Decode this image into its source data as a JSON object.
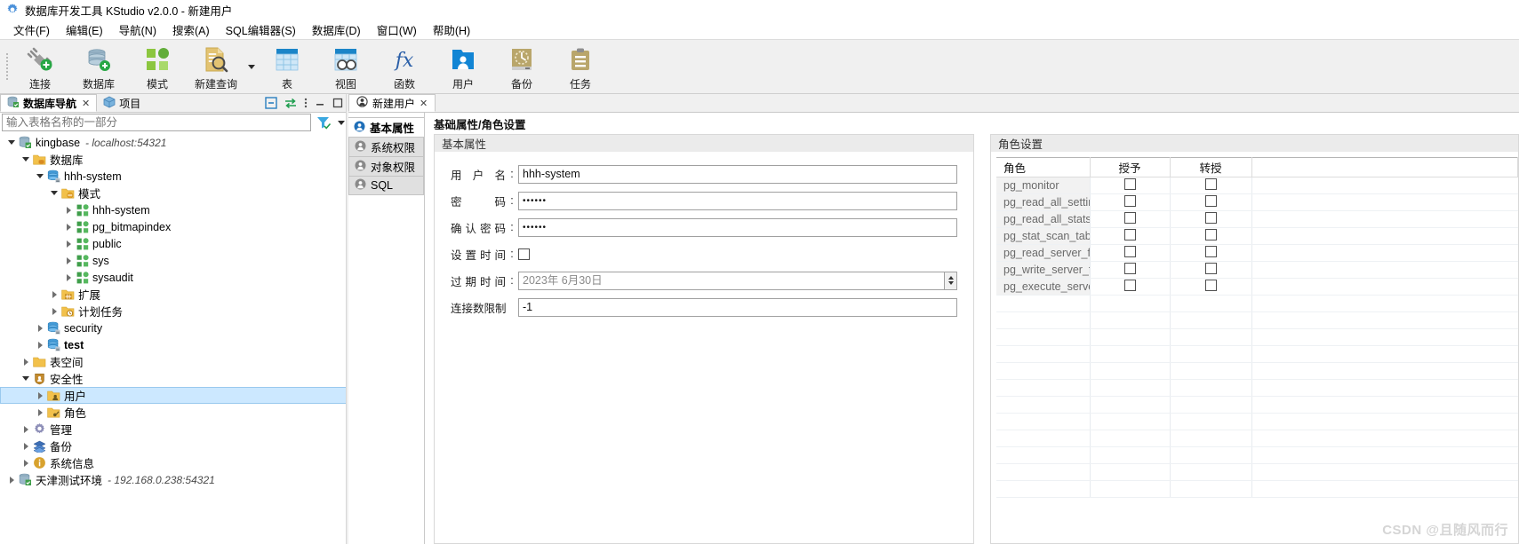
{
  "window": {
    "title": "数据库开发工具 KStudio v2.0.0 - 新建用户",
    "app_icon": "gear-icon"
  },
  "menubar": {
    "items": [
      {
        "label": "文件(F)"
      },
      {
        "label": "编辑(E)"
      },
      {
        "label": "导航(N)"
      },
      {
        "label": "搜索(A)"
      },
      {
        "label": "SQL编辑器(S)"
      },
      {
        "label": "数据库(D)"
      },
      {
        "label": "窗口(W)"
      },
      {
        "label": "帮助(H)"
      }
    ]
  },
  "toolbar": {
    "items": [
      {
        "label": "连接",
        "icon": "connect-icon"
      },
      {
        "label": "数据库",
        "icon": "database-icon"
      },
      {
        "label": "模式",
        "icon": "schema-icon"
      },
      {
        "label": "新建查询",
        "icon": "new-query-icon",
        "has_dropdown": true
      },
      {
        "label": "表",
        "icon": "table-icon"
      },
      {
        "label": "视图",
        "icon": "view-icon"
      },
      {
        "label": "函数",
        "icon": "function-icon"
      },
      {
        "label": "用户",
        "icon": "user-icon"
      },
      {
        "label": "备份",
        "icon": "backup-icon"
      },
      {
        "label": "任务",
        "icon": "task-icon"
      }
    ]
  },
  "left_panel": {
    "tabs": [
      {
        "label": "数据库导航",
        "icon": "database-nav-icon",
        "active": true,
        "closable": true
      },
      {
        "label": "项目",
        "icon": "project-icon",
        "active": false,
        "closable": false
      }
    ],
    "tools": [
      {
        "name": "collapse-all-icon"
      },
      {
        "name": "link-editor-icon"
      },
      {
        "name": "view-menu-icon"
      },
      {
        "name": "minimize-icon"
      },
      {
        "name": "maximize-icon"
      }
    ],
    "filter": {
      "placeholder": "输入表格名称的一部分",
      "value": "",
      "filter_icon": "filter-icon",
      "caret_icon": "chevron-down-icon"
    },
    "tree": [
      {
        "indent": 0,
        "twist": "down",
        "icon": "connection-icon",
        "label": "kingbase",
        "bold": false,
        "sub": "- localhost:54321",
        "selected": false
      },
      {
        "indent": 1,
        "twist": "down",
        "icon": "folder-db-icon",
        "label": "数据库",
        "bold": false,
        "sub": "",
        "selected": false
      },
      {
        "indent": 2,
        "twist": "down",
        "icon": "db-icon",
        "label": "hhh-system",
        "bold": false,
        "sub": "",
        "selected": false
      },
      {
        "indent": 3,
        "twist": "down",
        "icon": "folder-schema-icon",
        "label": "模式",
        "bold": false,
        "sub": "",
        "selected": false
      },
      {
        "indent": 4,
        "twist": "right",
        "icon": "schema-green-icon",
        "label": "hhh-system",
        "bold": false,
        "sub": "",
        "selected": false
      },
      {
        "indent": 4,
        "twist": "right",
        "icon": "schema-green-icon",
        "label": "pg_bitmapindex",
        "bold": false,
        "sub": "",
        "selected": false
      },
      {
        "indent": 4,
        "twist": "right",
        "icon": "schema-green-icon",
        "label": "public",
        "bold": false,
        "sub": "",
        "selected": false
      },
      {
        "indent": 4,
        "twist": "right",
        "icon": "schema-green-icon",
        "label": "sys",
        "bold": false,
        "sub": "",
        "selected": false
      },
      {
        "indent": 4,
        "twist": "right",
        "icon": "schema-green-icon",
        "label": "sysaudit",
        "bold": false,
        "sub": "",
        "selected": false
      },
      {
        "indent": 3,
        "twist": "right",
        "icon": "folder-extension-icon",
        "label": "扩展",
        "bold": false,
        "sub": "",
        "selected": false
      },
      {
        "indent": 3,
        "twist": "right",
        "icon": "folder-job-icon",
        "label": "计划任务",
        "bold": false,
        "sub": "",
        "selected": false
      },
      {
        "indent": 2,
        "twist": "right",
        "icon": "db-icon",
        "label": "security",
        "bold": false,
        "sub": "",
        "selected": false
      },
      {
        "indent": 2,
        "twist": "right",
        "icon": "db-icon",
        "label": "test",
        "bold": true,
        "sub": "",
        "selected": false
      },
      {
        "indent": 1,
        "twist": "right",
        "icon": "folder-icon",
        "label": "表空间",
        "bold": false,
        "sub": "",
        "selected": false
      },
      {
        "indent": 1,
        "twist": "down",
        "icon": "security-icon",
        "label": "安全性",
        "bold": false,
        "sub": "",
        "selected": false
      },
      {
        "indent": 2,
        "twist": "right",
        "icon": "folder-user-icon",
        "label": "用户",
        "bold": false,
        "sub": "",
        "selected": true
      },
      {
        "indent": 2,
        "twist": "right",
        "icon": "folder-role-icon",
        "label": "角色",
        "bold": false,
        "sub": "",
        "selected": false
      },
      {
        "indent": 1,
        "twist": "right",
        "icon": "admin-gear-icon",
        "label": "管理",
        "bold": false,
        "sub": "",
        "selected": false
      },
      {
        "indent": 1,
        "twist": "right",
        "icon": "backup-stack-icon",
        "label": "备份",
        "bold": false,
        "sub": "",
        "selected": false
      },
      {
        "indent": 1,
        "twist": "right",
        "icon": "info-icon",
        "label": "系统信息",
        "bold": false,
        "sub": "",
        "selected": false
      },
      {
        "indent": 0,
        "twist": "right",
        "icon": "connection-icon",
        "label": "天津测试环境",
        "bold": false,
        "sub": "- 192.168.0.238:54321",
        "selected": false
      }
    ]
  },
  "editor": {
    "tab": {
      "label": "新建用户",
      "icon": "user-circle-icon",
      "closable": true
    },
    "sidenav": [
      {
        "label": "基本属性",
        "icon": "user-circle-icon",
        "active": true
      },
      {
        "label": "系统权限",
        "icon": "user-circle-icon",
        "active": false
      },
      {
        "label": "对象权限",
        "icon": "user-circle-icon",
        "active": false
      },
      {
        "label": "SQL",
        "icon": "user-circle-icon",
        "active": false
      }
    ],
    "breadcrumb": "基础属性/角色设置",
    "basic_group": {
      "title": "基本属性",
      "fields": [
        {
          "label": "用 户 名",
          "type": "text",
          "value": "hhh-system",
          "placeholder": ""
        },
        {
          "label": "密    码",
          "type": "password",
          "value": "••••••",
          "placeholder": ""
        },
        {
          "label": "确认密码",
          "type": "password",
          "value": "••••••",
          "placeholder": ""
        },
        {
          "label": "设置时间",
          "type": "checkbox",
          "checked": false
        },
        {
          "label": "过期时间",
          "type": "spinner",
          "value": "",
          "placeholder": "2023年  6月30日"
        },
        {
          "label": "连接数限制",
          "type": "text",
          "value": "-1",
          "placeholder": "",
          "wide_label": true
        }
      ]
    },
    "role_group": {
      "title": "角色设置",
      "columns": [
        "角色",
        "授予",
        "转授",
        ""
      ],
      "rows": [
        {
          "role": "pg_monitor",
          "grant": false,
          "admin": false
        },
        {
          "role": "pg_read_all_settings",
          "grant": false,
          "admin": false
        },
        {
          "role": "pg_read_all_stats",
          "grant": false,
          "admin": false
        },
        {
          "role": "pg_stat_scan_tables",
          "grant": false,
          "admin": false
        },
        {
          "role": "pg_read_server_files",
          "grant": false,
          "admin": false
        },
        {
          "role": "pg_write_server_files",
          "grant": false,
          "admin": false
        },
        {
          "role": "pg_execute_server_program",
          "grant": false,
          "admin": false
        }
      ]
    }
  },
  "watermark": "CSDN @且随风而行",
  "colors": {
    "accent": "#0a6fc2",
    "selection": "#cce8ff",
    "toolbar_bg": "#f0f0f0",
    "group_header": "#ebebeb"
  }
}
